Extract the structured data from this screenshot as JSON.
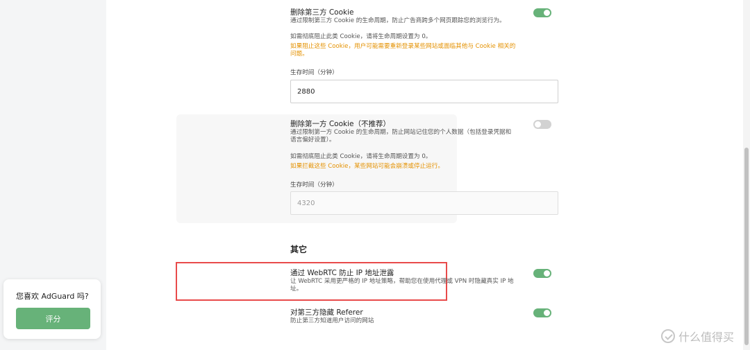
{
  "sidebar": {
    "rate_prompt": "您喜欢 AdGuard 吗?",
    "rate_button": "评分"
  },
  "third_party_cookie": {
    "title": "删除第三方 Cookie",
    "desc": "通过限制第三方 Cookie 的生命周期，防止广告商跨多个网页跟踪您的浏览行为。",
    "hint": "如需彻底阻止此类 Cookie，请将生命周期设置为 0。",
    "warning_line1": "如果阻止这些 Cookie，用户可能需要重新登录某些网站或面临其他与 Cookie 相关的",
    "warning_line2": "问题。",
    "field_label": "生存时间（分钟）",
    "value": "2880",
    "enabled": true
  },
  "first_party_cookie": {
    "title": "删除第一方 Cookie（不推荐）",
    "desc_line1": "通过限制第一方 Cookie 的生命周期，防止网站记住您的个人数据（包括登录凭据和",
    "desc_line2": "语言偏好设置）。",
    "hint": "如需彻底阻止此类 Cookie，请将生命周期设置为 0。",
    "warning": "如果拦截这些 Cookie，某些网站可能会崩溃或停止运行。",
    "field_label": "生存时间（分钟）",
    "value": "4320",
    "enabled": false
  },
  "misc": {
    "heading": "其它",
    "webrtc": {
      "title": "通过 WebRTC 防止 IP 地址泄露",
      "desc_line1": "让 WebRTC 采用更严格的 IP 地址策略，帮助您在使用代理或 VPN 时隐藏真实 IP 地",
      "desc_line2": "址。",
      "enabled": true
    },
    "referer": {
      "title": "对第三方隐藏 Referer",
      "desc": "防止第三方知道用户访问的网站",
      "enabled": true
    }
  },
  "watermark": {
    "text": "什么值得买"
  },
  "colors": {
    "accent": "#67b279",
    "warning": "#e49100",
    "highlight": "#e84a4a"
  }
}
